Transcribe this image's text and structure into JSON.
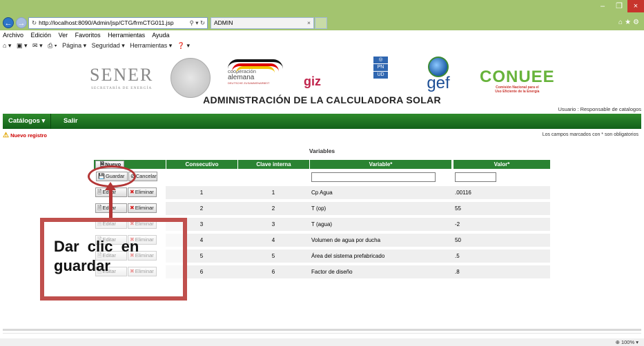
{
  "browser": {
    "url": "http://localhost:8090/Admin/jsp/CTG/frmCTG011.jsp",
    "tab_title": "ADMIN",
    "menu": [
      "Archivo",
      "Edición",
      "Ver",
      "Favoritos",
      "Herramientas",
      "Ayuda"
    ],
    "commands": [
      "Página ▾",
      "Seguridad ▾",
      "Herramientas ▾"
    ],
    "zoom": "100%"
  },
  "header": {
    "sener": "SENER",
    "sener_sub": "SECRETARÍA DE ENERGÍA",
    "coop_line1": "cooperación",
    "coop_line2": "alemana",
    "coop_line3": "DEUTSCHE ZUSAMMENARBEIT",
    "giz": "giz",
    "pnud": [
      "P",
      "N",
      "U",
      "D"
    ],
    "gef": "gef",
    "conuee": "CONUEE",
    "conuee_sub1": "Comisión Nacional para el",
    "conuee_sub2": "Uso Eficiente de la Energía",
    "title": "ADMINISTRACIÓN DE LA CALCULADORA SOLAR",
    "usuario": "Usuario : Responsable de catalogos"
  },
  "nav": {
    "catalogos": "Catálogos ▾",
    "salir": "Salir"
  },
  "form": {
    "status": "Nuevo registro",
    "required_note": "Los campos marcados con * son obligatorios",
    "title": "Variables"
  },
  "table": {
    "headers": {
      "consecutivo": "Consecutivo",
      "clave": "Clave interna",
      "variable": "Variable*",
      "valor": "Valor*"
    },
    "buttons": {
      "nuevo": "Nuevo",
      "guardar": "Guardar",
      "cancelar": "Cancelar",
      "editar": "Editar",
      "eliminar": "Eliminar"
    },
    "rows": [
      {
        "consecutivo": "1",
        "clave": "1",
        "variable": "Cp Agua",
        "valor": ".00116"
      },
      {
        "consecutivo": "2",
        "clave": "2",
        "variable": "T (op)",
        "valor": "55"
      },
      {
        "consecutivo": "3",
        "clave": "3",
        "variable": "T (agua)",
        "valor": "-2"
      },
      {
        "consecutivo": "4",
        "clave": "4",
        "variable": "Volumen de agua por ducha",
        "valor": "50"
      },
      {
        "consecutivo": "5",
        "clave": "5",
        "variable": "Área del sistema prefabricado",
        "valor": ".5"
      },
      {
        "consecutivo": "6",
        "clave": "6",
        "variable": "Factor de diseño",
        "valor": ".8"
      }
    ]
  },
  "annotation": {
    "text": "Dar clic en guardar",
    "color": "#c0504d"
  }
}
